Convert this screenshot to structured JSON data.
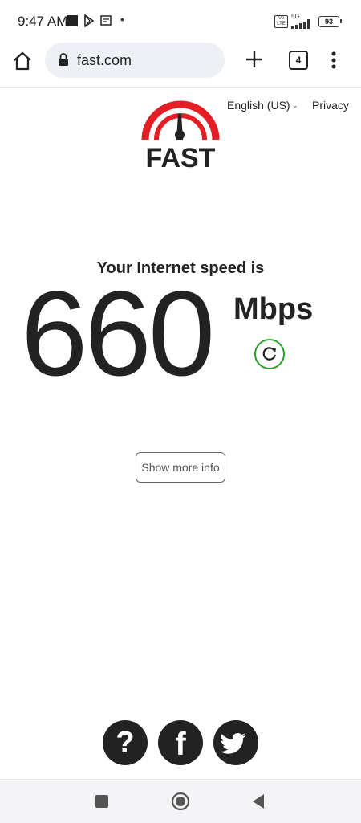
{
  "status_bar": {
    "time": "9:47 AM",
    "network_lte": "Vo LTE",
    "network_5g": "5G",
    "battery": "93",
    "icons": [
      "stop-square-icon",
      "play-store-icon",
      "news-icon",
      "dot-icon",
      "signal-icon",
      "battery-icon"
    ]
  },
  "browser": {
    "url": "fast.com",
    "tab_count": "4",
    "icons": [
      "home-icon",
      "lock-icon",
      "plus-icon",
      "tabs-icon",
      "overflow-menu-icon"
    ]
  },
  "page": {
    "language": "English (US)",
    "privacy": "Privacy",
    "logo_text": "FAST",
    "speed_label": "Your Internet speed is",
    "speed_value": "660",
    "speed_unit": "Mbps",
    "more_info_button": "Show more info",
    "colors": {
      "brand_red": "#e31e24",
      "refresh_green": "#2ca02c",
      "text_dark": "#222222"
    }
  },
  "social": {
    "help": "?",
    "facebook": "f",
    "icons": [
      "help-icon",
      "facebook-icon",
      "twitter-icon"
    ]
  },
  "nav_bar": {
    "icons": [
      "recents-icon",
      "home-circle-icon",
      "back-icon"
    ]
  }
}
